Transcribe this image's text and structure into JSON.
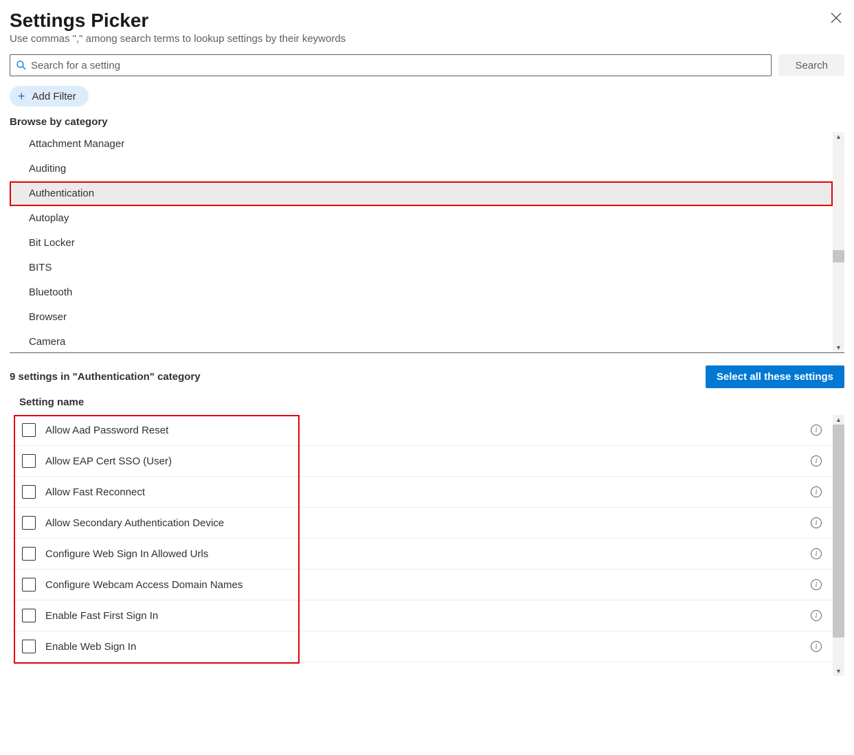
{
  "title": "Settings Picker",
  "subtitle": "Use commas \",\" among search terms to lookup settings by their keywords",
  "search": {
    "placeholder": "Search for a setting",
    "button": "Search"
  },
  "add_filter": "Add Filter",
  "browse_label": "Browse by category",
  "categories": [
    {
      "label": "Attachment Manager",
      "selected": false
    },
    {
      "label": "Auditing",
      "selected": false
    },
    {
      "label": "Authentication",
      "selected": true
    },
    {
      "label": "Autoplay",
      "selected": false
    },
    {
      "label": "Bit Locker",
      "selected": false
    },
    {
      "label": "BITS",
      "selected": false
    },
    {
      "label": "Bluetooth",
      "selected": false
    },
    {
      "label": "Browser",
      "selected": false
    },
    {
      "label": "Camera",
      "selected": false
    }
  ],
  "results_count_text": "9 settings in \"Authentication\" category",
  "select_all_label": "Select all these settings",
  "column_header": "Setting name",
  "settings": [
    {
      "name": "Allow Aad Password Reset"
    },
    {
      "name": "Allow EAP Cert SSO (User)"
    },
    {
      "name": "Allow Fast Reconnect"
    },
    {
      "name": "Allow Secondary Authentication Device"
    },
    {
      "name": "Configure Web Sign In Allowed Urls"
    },
    {
      "name": "Configure Webcam Access Domain Names"
    },
    {
      "name": "Enable Fast First Sign In"
    },
    {
      "name": "Enable Web Sign In"
    }
  ]
}
